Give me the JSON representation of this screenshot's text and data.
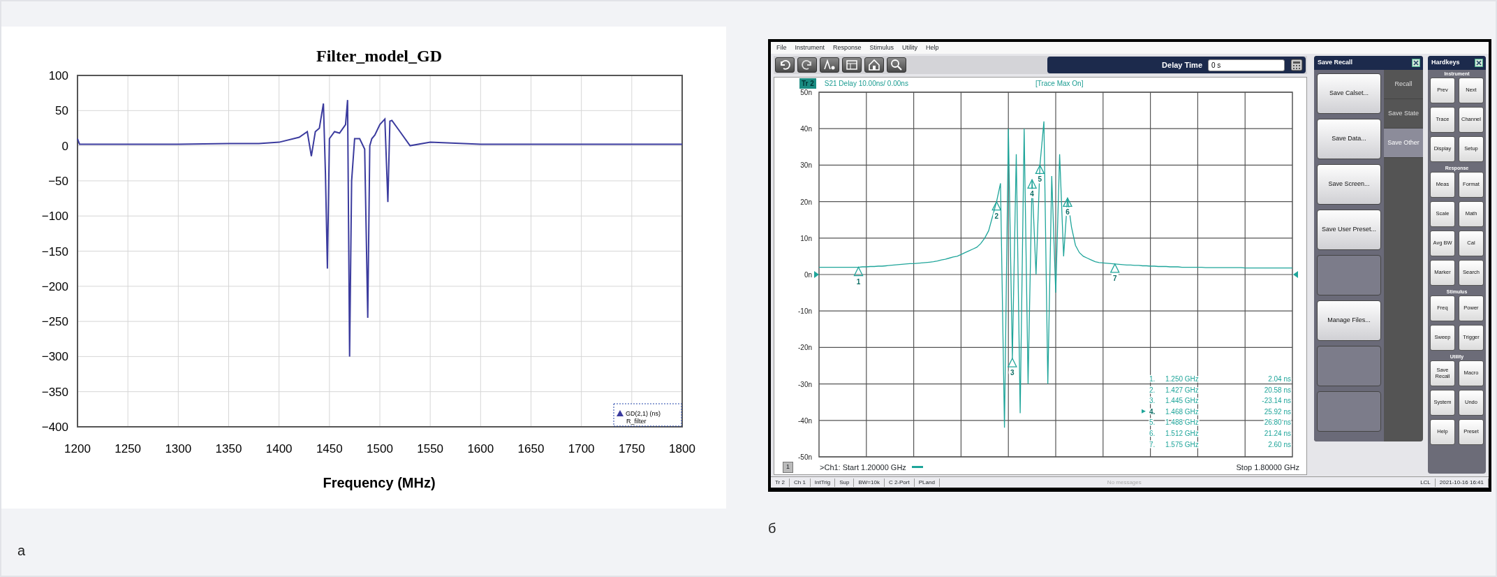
{
  "figure_a": {
    "label": "а",
    "chart": {
      "legend_note": "R_filter",
      "chart_data": {
        "type": "line",
        "title": "Filter_model_GD",
        "xlabel": "Frequency (MHz)",
        "grid": true,
        "x": [
          1200,
          1202,
          1205,
          1250,
          1300,
          1350,
          1380,
          1400,
          1420,
          1428,
          1432,
          1436,
          1440,
          1444,
          1446,
          1448,
          1450,
          1455,
          1460,
          1466,
          1468,
          1470,
          1472,
          1475,
          1480,
          1485,
          1488,
          1490,
          1492,
          1495,
          1500,
          1505,
          1508,
          1510,
          1512,
          1520,
          1530,
          1550,
          1600,
          1700,
          1800
        ],
        "series": [
          {
            "name": "GD(2,1) (ns)",
            "color": "#3b3b9e",
            "values": [
              10,
              2,
              2,
              2,
              2,
              3,
              3,
              5,
              12,
              20,
              -15,
              20,
              25,
              60,
              -40,
              -175,
              10,
              20,
              18,
              30,
              65,
              -300,
              -50,
              10,
              10,
              -5,
              -245,
              0,
              10,
              15,
              30,
              38,
              -80,
              35,
              36,
              20,
              0,
              5,
              2,
              2,
              2
            ]
          }
        ],
        "xlim": [
          1200,
          1800
        ],
        "ylim": [
          -400,
          100
        ],
        "xticks": [
          1200,
          1250,
          1300,
          1350,
          1400,
          1450,
          1500,
          1550,
          1600,
          1650,
          1700,
          1750,
          1800
        ],
        "yticks": [
          {
            "value": -400,
            "label": "−400"
          },
          {
            "value": -350,
            "label": "−350"
          },
          {
            "value": -300,
            "label": "−300"
          },
          {
            "value": -250,
            "label": "−250"
          },
          {
            "value": -200,
            "label": "−200"
          },
          {
            "value": -150,
            "label": "−150"
          },
          {
            "value": -100,
            "label": "−100"
          },
          {
            "value": -50,
            "label": "−50"
          },
          0,
          50,
          100
        ]
      }
    }
  },
  "figure_b": {
    "label": "б",
    "screen": {
      "menu": [
        "File",
        "Instrument",
        "Response",
        "Stimulus",
        "Utility",
        "Help"
      ],
      "toolbar": [
        {
          "kind": "undo"
        },
        {
          "kind": "redo"
        },
        {
          "kind": "marker"
        },
        {
          "kind": "table"
        },
        {
          "kind": "house"
        },
        {
          "kind": "zoom"
        }
      ],
      "delay": {
        "label": "Delay Time",
        "value": "0 s"
      },
      "trace_header": {
        "trace": "Tr 2",
        "scale": "S21 Delay 10.00ns/ 0.00ns",
        "status": "[Trace Max On]"
      },
      "plot": {
        "chart_data": {
          "type": "line",
          "grid": true,
          "categories": [
            null,
            null,
            null,
            null,
            null,
            null,
            null,
            null,
            null,
            null,
            null,
            null,
            null,
            null,
            null,
            null,
            null,
            null,
            null,
            null,
            null,
            null,
            null,
            null,
            null,
            null,
            null,
            null,
            null,
            null,
            null,
            null,
            null,
            null,
            null,
            null,
            null,
            null,
            null,
            null,
            null,
            null,
            null,
            null,
            null,
            null,
            null,
            null,
            null,
            null,
            null,
            null,
            null,
            null,
            null,
            null,
            null,
            null,
            null,
            null,
            null,
            null,
            null,
            null,
            null,
            null,
            null,
            null,
            null,
            null,
            null,
            null,
            null,
            null,
            null,
            null,
            null,
            null,
            null,
            null,
            null,
            null,
            null,
            null,
            null,
            null,
            null,
            null,
            null,
            null,
            null,
            null,
            null,
            null,
            null,
            null,
            null,
            null,
            null,
            null,
            null,
            null,
            null,
            null,
            null,
            null,
            null,
            null,
            null,
            null,
            null,
            null,
            null,
            null,
            null,
            null,
            null,
            null,
            null,
            null,
            null
          ],
          "series": [
            {
              "color": "#1fa59a",
              "values": [
                2,
                2,
                2,
                2,
                2,
                2,
                2,
                2,
                2,
                2,
                2,
                2.1,
                2.1,
                2.2,
                2.2,
                2.3,
                2.3,
                2.4,
                2.5,
                2.6,
                2.7,
                2.8,
                2.9,
                3,
                3,
                3.1,
                3.2,
                3.3,
                3.4,
                3.5,
                3.7,
                4,
                4.2,
                4.5,
                4.8,
                5,
                5.5,
                6,
                6.5,
                7,
                7.5,
                8.5,
                10,
                12,
                16,
                20,
                25,
                -42,
                40,
                -23,
                33,
                -38,
                40,
                -30,
                26,
                0,
                30,
                42,
                -30,
                27,
                -5,
                33,
                5,
                21,
                13,
                8,
                6,
                5,
                4.5,
                4,
                3.5,
                3.3,
                3.2,
                3.1,
                3,
                2.9,
                2.8,
                2.7,
                2.6,
                2.6,
                2.5,
                2.5,
                2.4,
                2.4,
                2.3,
                2.3,
                2.2,
                2.2,
                2.2,
                2.1,
                2.1,
                2.1,
                2,
                2,
                2,
                2,
                2,
                2,
                1.9,
                1.9,
                1.9,
                1.9,
                1.9,
                1.9,
                1.9,
                1.9,
                1.9,
                1.9,
                1.8,
                1.8,
                1.8,
                1.8,
                1.8,
                1.8,
                1.8,
                1.8,
                1.8,
                1.8,
                1.8,
                1.8,
                1.8
              ]
            }
          ],
          "ylim": [
            -50,
            50
          ],
          "yticks": [
            {
              "value": 50,
              "label": "50n"
            },
            {
              "value": 40,
              "label": "40n"
            },
            {
              "value": 30,
              "label": "30n"
            },
            {
              "value": 20,
              "label": "20n"
            },
            {
              "value": 10,
              "label": "10n"
            },
            {
              "value": 0,
              "label": "0n"
            },
            {
              "value": -10,
              "label": "-10n"
            },
            {
              "value": -20,
              "label": "-20n"
            },
            {
              "value": -30,
              "label": "-30n"
            },
            {
              "value": -40,
              "label": "-40n"
            },
            {
              "value": -50,
              "label": "-50n"
            }
          ]
        },
        "markers": [
          {
            "text": "1",
            "level": 0.0833
          },
          {
            "text": "2",
            "level": 0.375
          },
          {
            "text": "3",
            "level": 0.4083
          },
          {
            "text": "4",
            "level": 0.45
          },
          {
            "text": "5",
            "level": 0.4667
          },
          {
            "text": "6",
            "level": 0.525
          },
          {
            "text": "7",
            "level": 0.625
          }
        ],
        "marker_table": [
          {
            "number": "1.",
            "frequency": "1.250 GHz",
            "value": "2.04 ns",
            "active": false
          },
          {
            "number": "2.",
            "frequency": "1.427 GHz",
            "value": "20.58 ns",
            "active": false
          },
          {
            "number": "3.",
            "frequency": "1.445 GHz",
            "value": "-23.14 ns",
            "active": false
          },
          {
            "number": "4.",
            "frequency": "1.468 GHz",
            "value": "25.92 ns",
            "active": true
          },
          {
            "number": "5.",
            "frequency": "1.488 GHz",
            "value": "26.80 ns",
            "active": false
          },
          {
            "number": "6.",
            "frequency": "1.512 GHz",
            "value": "21.24 ns",
            "active": false
          },
          {
            "number": "7.",
            "frequency": "1.575 GHz",
            "value": "2.60 ns",
            "active": false
          }
        ]
      },
      "footer": {
        "channel_box": "1",
        "start": ">Ch1: Start  1.20000 GHz",
        "stop": "Stop  1.80000 GHz"
      },
      "save_recall": {
        "title": "Save Recall",
        "buttons": [
          {
            "label": "Save Calset...",
            "disabled": false
          },
          {
            "label": "Save Data...",
            "disabled": false
          },
          {
            "label": "Save Screen...",
            "disabled": false
          },
          {
            "label": "Save User Preset...",
            "disabled": false
          },
          {
            "disabled": true
          },
          {
            "label": "Manage Files...",
            "disabled": false
          },
          {
            "disabled": true
          },
          {
            "disabled": true
          }
        ],
        "tabs": [
          {
            "label": "Recall",
            "selected": false
          },
          {
            "label": "Save State",
            "selected": false
          },
          {
            "label": "Save Other",
            "selected": true
          }
        ]
      },
      "hardkeys": {
        "title": "Hardkeys",
        "groups": [
          {
            "label": "Instrument",
            "keys": [
              "Prev",
              "Next",
              "Trace",
              "Channel",
              "Display",
              "Setup"
            ]
          },
          {
            "label": "Response",
            "keys": [
              "Meas",
              "Format",
              "Scale",
              "Math",
              "Avg BW",
              "Cal",
              "Marker",
              "Search"
            ]
          },
          {
            "label": "Stimulus",
            "keys": [
              "Freq",
              "Power",
              "Sweep",
              "Trigger"
            ]
          },
          {
            "label": "Utility",
            "keys": [
              "Save Recall",
              "Macro",
              "System",
              "Undo",
              "Help",
              "Preset"
            ]
          }
        ]
      },
      "status_bar": {
        "items": [
          "Tr 2",
          "Ch 1",
          "IntTrig",
          "Sup",
          "BW=10k",
          "C 2-Port",
          "PLand"
        ],
        "message": "No messages",
        "mode": "LCL",
        "datetime": "2021-10-16 16:41"
      }
    }
  }
}
